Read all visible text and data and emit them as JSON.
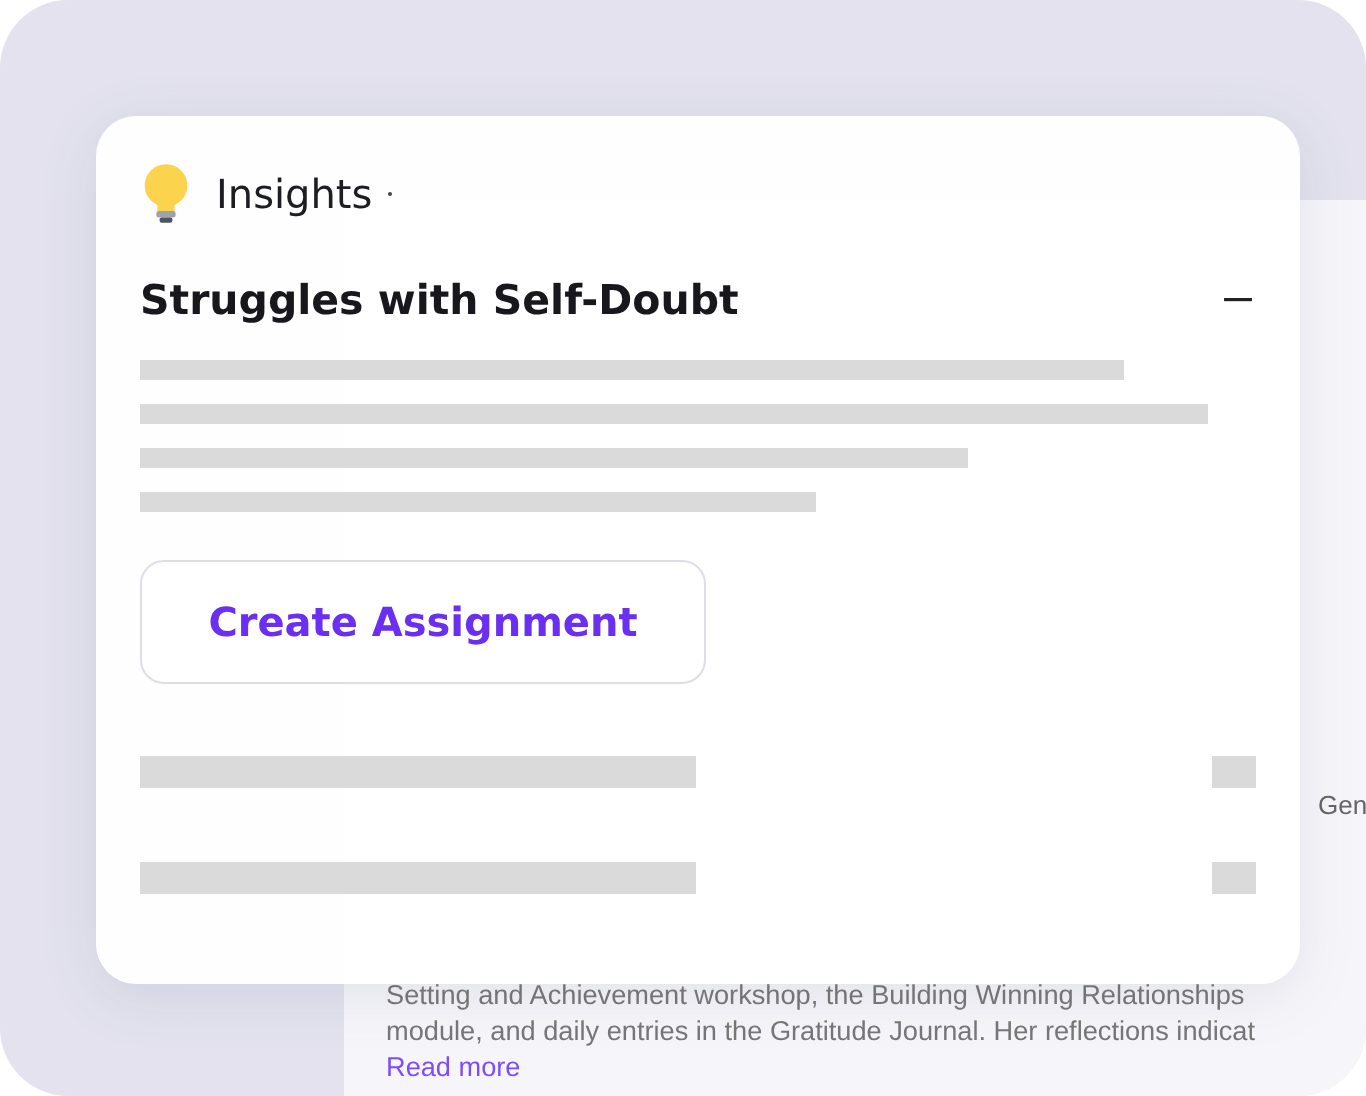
{
  "background_panel": {
    "tag": "Gen",
    "summary_lines": [
      "Setting and Achievement workshop, the Building Winning Relationships",
      "module, and daily entries in the Gratitude Journal. Her reflections indicat"
    ],
    "link": "Read more"
  },
  "card": {
    "title": "Insights",
    "heading": "Struggles with Self-Doubt",
    "expanded": true,
    "button": "Create Assignment"
  }
}
